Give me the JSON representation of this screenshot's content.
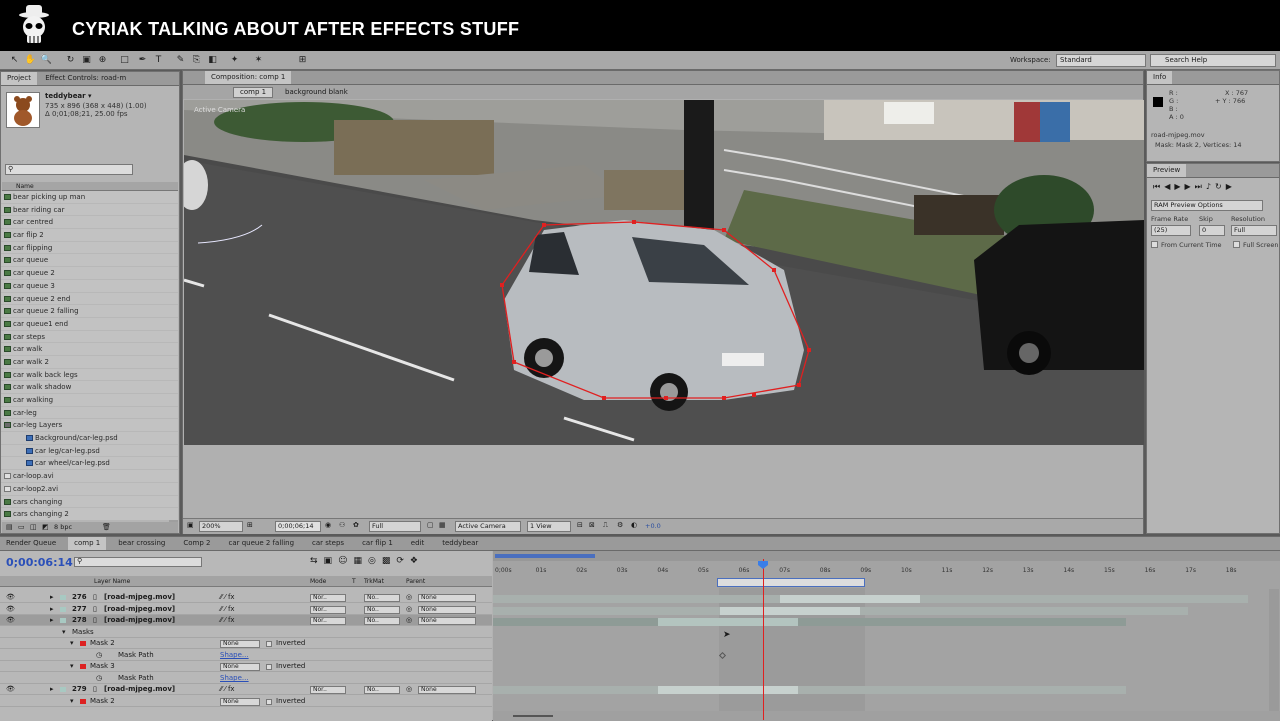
{
  "banner": {
    "title": "CYRIAK TALKING ABOUT AFTER EFFECTS STUFF",
    "logo_icon": "skull-bowler-hat-icon"
  },
  "toolbar": {
    "tools": [
      "selection-tool-icon",
      "hand-tool-icon",
      "zoom-tool-icon",
      "rotate-tool-icon",
      "camera-tool-icon",
      "pan-behind-tool-icon",
      "mask-tool-icon",
      "pen-tool-icon",
      "type-tool-icon",
      "brush-tool-icon",
      "clone-tool-icon",
      "eraser-tool-icon",
      "roto-brush-tool-icon",
      "puppet-tool-icon"
    ],
    "type_glyph": "T",
    "workspace_label": "Workspace:",
    "workspace_value": "Standard",
    "search_placeholder": "Search Help"
  },
  "project_panel": {
    "tabs": [
      "Project",
      "Effect Controls: road-m"
    ],
    "asset_name": "teddybear ▾",
    "asset_info_1": "735 x 896  (368 x 448) (1.00)",
    "asset_info_2": "Δ 0;01;08;21, 25.00 fps",
    "column_name": "Name",
    "items": [
      {
        "label": "bear picking up man",
        "kind": "comp"
      },
      {
        "label": "bear riding car",
        "kind": "comp"
      },
      {
        "label": "car centred",
        "kind": "comp"
      },
      {
        "label": "car flip 2",
        "kind": "comp"
      },
      {
        "label": "car flipping",
        "kind": "comp"
      },
      {
        "label": "car queue",
        "kind": "comp"
      },
      {
        "label": "car queue 2",
        "kind": "comp"
      },
      {
        "label": "car queue 3",
        "kind": "comp"
      },
      {
        "label": "car queue 2 end",
        "kind": "comp"
      },
      {
        "label": "car queue 2 falling",
        "kind": "comp"
      },
      {
        "label": "car queue1 end",
        "kind": "comp"
      },
      {
        "label": "car steps",
        "kind": "comp"
      },
      {
        "label": "car walk",
        "kind": "comp"
      },
      {
        "label": "car walk 2",
        "kind": "comp"
      },
      {
        "label": "car walk back legs",
        "kind": "comp"
      },
      {
        "label": "car walk shadow",
        "kind": "comp"
      },
      {
        "label": "car walking",
        "kind": "comp"
      },
      {
        "label": "car-leg",
        "kind": "comp"
      },
      {
        "label": "car-leg Layers",
        "kind": "folder"
      },
      {
        "label": "Background/car-leg.psd",
        "kind": "sub"
      },
      {
        "label": "car leg/car-leg.psd",
        "kind": "sub"
      },
      {
        "label": "car wheel/car-leg.psd",
        "kind": "sub"
      },
      {
        "label": "car-loop.avi",
        "kind": "avi"
      },
      {
        "label": "car-loop2.avi",
        "kind": "avi"
      },
      {
        "label": "cars changing",
        "kind": "comp"
      },
      {
        "label": "cars changing 2",
        "kind": "comp"
      }
    ],
    "bpc": "8 bpc"
  },
  "composition": {
    "tab_label": "Composition: comp 1",
    "breadcrumb": [
      "comp 1",
      "background blank"
    ],
    "camera_label": "Active Camera",
    "footer": {
      "zoom": "200%",
      "timecode": "0;00;06;14",
      "resolution": "Full",
      "camera": "Active Camera",
      "view": "1 View",
      "exposure": "+0.0"
    }
  },
  "info_panel": {
    "title": "Info",
    "r": "R :",
    "g": "G :",
    "b": "B :",
    "a": "A : 0",
    "x": "X : 767",
    "y": "+ Y : 766",
    "layer_name": "road-mjpeg.mov",
    "mask_info": "Mask: Mask 2, Vertices: 14"
  },
  "preview_panel": {
    "title": "Preview",
    "ram_preview": "RAM Preview Options",
    "frame_rate_label": "Frame Rate",
    "frame_rate": "(25)",
    "skip_label": "Skip",
    "skip": "0",
    "resolution_label": "Resolution",
    "resolution": "Full",
    "from_current": "From Current Time",
    "full_screen": "Full Screen"
  },
  "timeline": {
    "tabs": [
      "Render Queue",
      "comp 1",
      "bear crossing",
      "Comp 2",
      "car queue 2 falling",
      "car steps",
      "car flip 1",
      "edit",
      "teddybear"
    ],
    "current_time": "0;00:06:14",
    "columns": {
      "layer_name": "Layer Name",
      "mode": "Mode",
      "trkmat": "TrkMat",
      "parent": "Parent",
      "t": "T"
    },
    "layers": [
      {
        "num": "276",
        "name": "[road-mjpeg.mov]",
        "mode": "Nor..",
        "trk": "No..",
        "parent": "None"
      },
      {
        "num": "277",
        "name": "[road-mjpeg.mov]",
        "mode": "Nor..",
        "trk": "No..",
        "parent": "None"
      },
      {
        "num": "278",
        "name": "[road-mjpeg.mov]",
        "mode": "Nor..",
        "trk": "No..",
        "parent": "None"
      }
    ],
    "masks_label": "Masks",
    "mask2": {
      "name": "Mask 2",
      "mode": "None",
      "inverted": "Inverted",
      "path_label": "Mask Path",
      "shape": "Shape..."
    },
    "mask3": {
      "name": "Mask 3",
      "mode": "None",
      "inverted": "Inverted",
      "path_label": "Mask Path",
      "shape": "Shape..."
    },
    "layer279": {
      "num": "279",
      "name": "[road-mjpeg.mov]",
      "mode": "Nor..",
      "trk": "No..",
      "parent": "None"
    },
    "mask2b": {
      "name": "Mask 2",
      "mode": "None",
      "inverted": "Inverted"
    },
    "ruler": [
      "0;00s",
      "01s",
      "02s",
      "03s",
      "04s",
      "05s",
      "06s",
      "07s",
      "08s",
      "09s",
      "10s",
      "11s",
      "12s",
      "13s",
      "14s",
      "15s",
      "16s",
      "17s",
      "18s"
    ]
  }
}
